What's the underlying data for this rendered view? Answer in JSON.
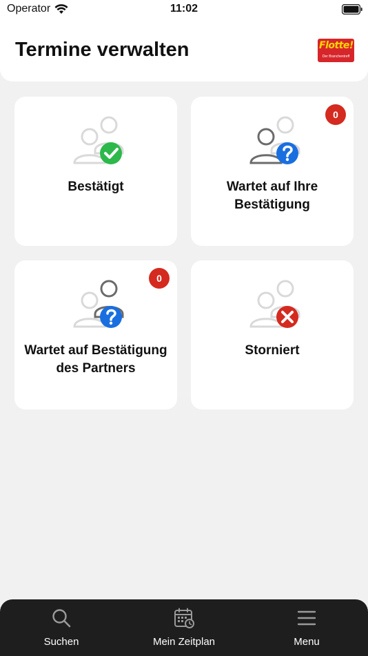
{
  "status_bar": {
    "carrier": "Operator",
    "time": "11:02"
  },
  "header": {
    "title": "Termine verwalten",
    "logo_text": "Flotte!",
    "logo_subtext": "Der Branchentreff"
  },
  "cards": [
    {
      "label": "Bestätigt",
      "icon": "users-check-icon"
    },
    {
      "label": "Wartet auf Ihre Bestätigung",
      "icon": "users-question-icon",
      "badge": "0"
    },
    {
      "label": "Wartet auf Bestätigung des Partners",
      "icon": "partner-question-icon",
      "badge": "0"
    },
    {
      "label": "Storniert",
      "icon": "users-cancel-icon"
    }
  ],
  "tab_bar": {
    "items": [
      {
        "label": "Suchen",
        "icon": "search-icon"
      },
      {
        "label": "Mein Zeitplan",
        "icon": "calendar-clock-icon"
      },
      {
        "label": "Menu",
        "icon": "hamburger-menu-icon"
      }
    ]
  },
  "colors": {
    "accent_green": "#2db84b",
    "accent_blue": "#1a6fe0",
    "accent_red": "#d42a1f",
    "tab_bar_bg": "#1e1e1e",
    "page_bg": "#f1f1f1"
  }
}
